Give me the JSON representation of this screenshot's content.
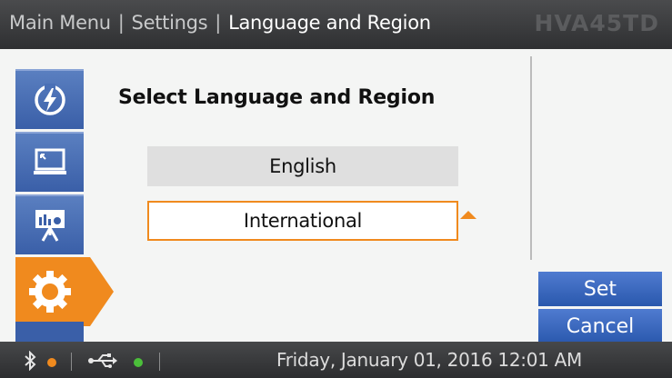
{
  "header": {
    "breadcrumbs": [
      "Main Menu",
      "Settings",
      "Language and Region"
    ],
    "separator": "|",
    "model": "HVA45TD"
  },
  "nav": {
    "items": [
      {
        "name": "power",
        "icon": "power-bolt-icon",
        "active": false
      },
      {
        "name": "display",
        "icon": "monitor-icon",
        "active": false
      },
      {
        "name": "presentation",
        "icon": "presentation-icon",
        "active": false
      },
      {
        "name": "settings",
        "icon": "gear-icon",
        "active": true
      }
    ]
  },
  "main": {
    "title": "Select Language and Region",
    "options": [
      {
        "label": "English",
        "selected": false
      },
      {
        "label": "International",
        "selected": true
      }
    ]
  },
  "actions": {
    "set_label": "Set",
    "cancel_label": "Cancel"
  },
  "statusbar": {
    "bluetooth_icon": "bluetooth-icon",
    "bluetooth_status_color": "#f08a1e",
    "usb_icon": "usb-icon",
    "usb_status_color": "#4bbf3a",
    "datetime": "Friday, January 01, 2016 12:01 AM"
  },
  "colors": {
    "accent_orange": "#f08a1e",
    "nav_blue": "#3a5fa8",
    "button_blue": "#2f5fb6"
  }
}
